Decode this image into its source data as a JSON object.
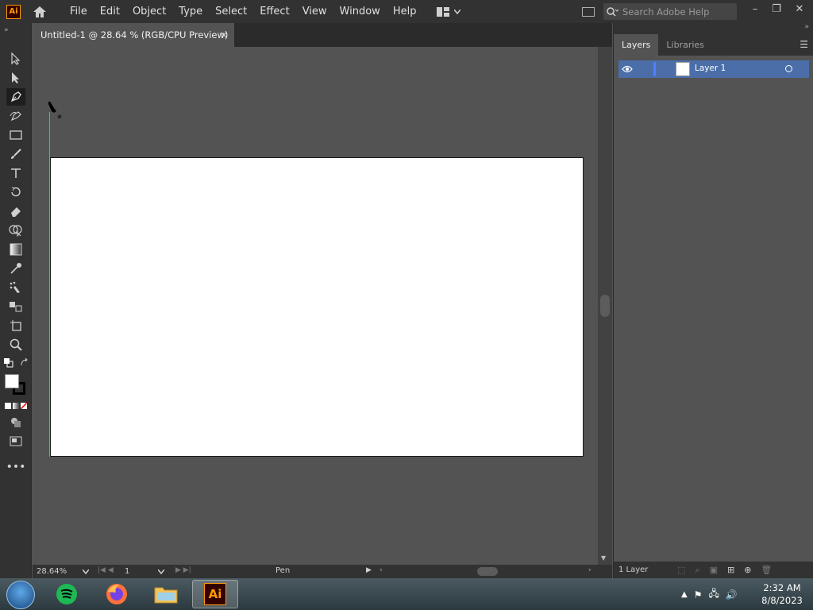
{
  "app": {
    "logo": "Ai"
  },
  "menu": [
    "File",
    "Edit",
    "Object",
    "Type",
    "Select",
    "Effect",
    "View",
    "Window",
    "Help"
  ],
  "search": {
    "placeholder": "Search Adobe Help"
  },
  "document": {
    "tab_title": "Untitled-1 @ 28.64 % (RGB/CPU Preview)",
    "close": "×"
  },
  "tools": [
    "selection-tool",
    "direct-selection-tool",
    "pen-tool",
    "curvature-tool",
    "rectangle-tool",
    "paintbrush-tool",
    "type-tool",
    "rotate-tool",
    "eraser-tool",
    "shape-builder-tool",
    "gradient-tool",
    "eyedropper-tool",
    "blend-tool",
    "symbol-sprayer-tool",
    "artboard-tool",
    "zoom-tool"
  ],
  "status": {
    "zoom": "28.64%",
    "page": "1",
    "current_tool": "Pen"
  },
  "panels": {
    "tabs": [
      "Layers",
      "Libraries"
    ],
    "layers": [
      {
        "name": "Layer 1",
        "color": "#4f80ff"
      }
    ],
    "count_label": "1 Layer"
  },
  "taskbar": {
    "apps": [
      "spotify",
      "firefox",
      "file-explorer",
      "illustrator"
    ],
    "active_app": "illustrator",
    "illustrator_label": "Ai",
    "time": "2:32 AM",
    "date": "8/8/2023"
  },
  "colors": {
    "accent": "#4b6ea9",
    "guide": "#d966c8",
    "ai_orange": "#ff9a00"
  }
}
